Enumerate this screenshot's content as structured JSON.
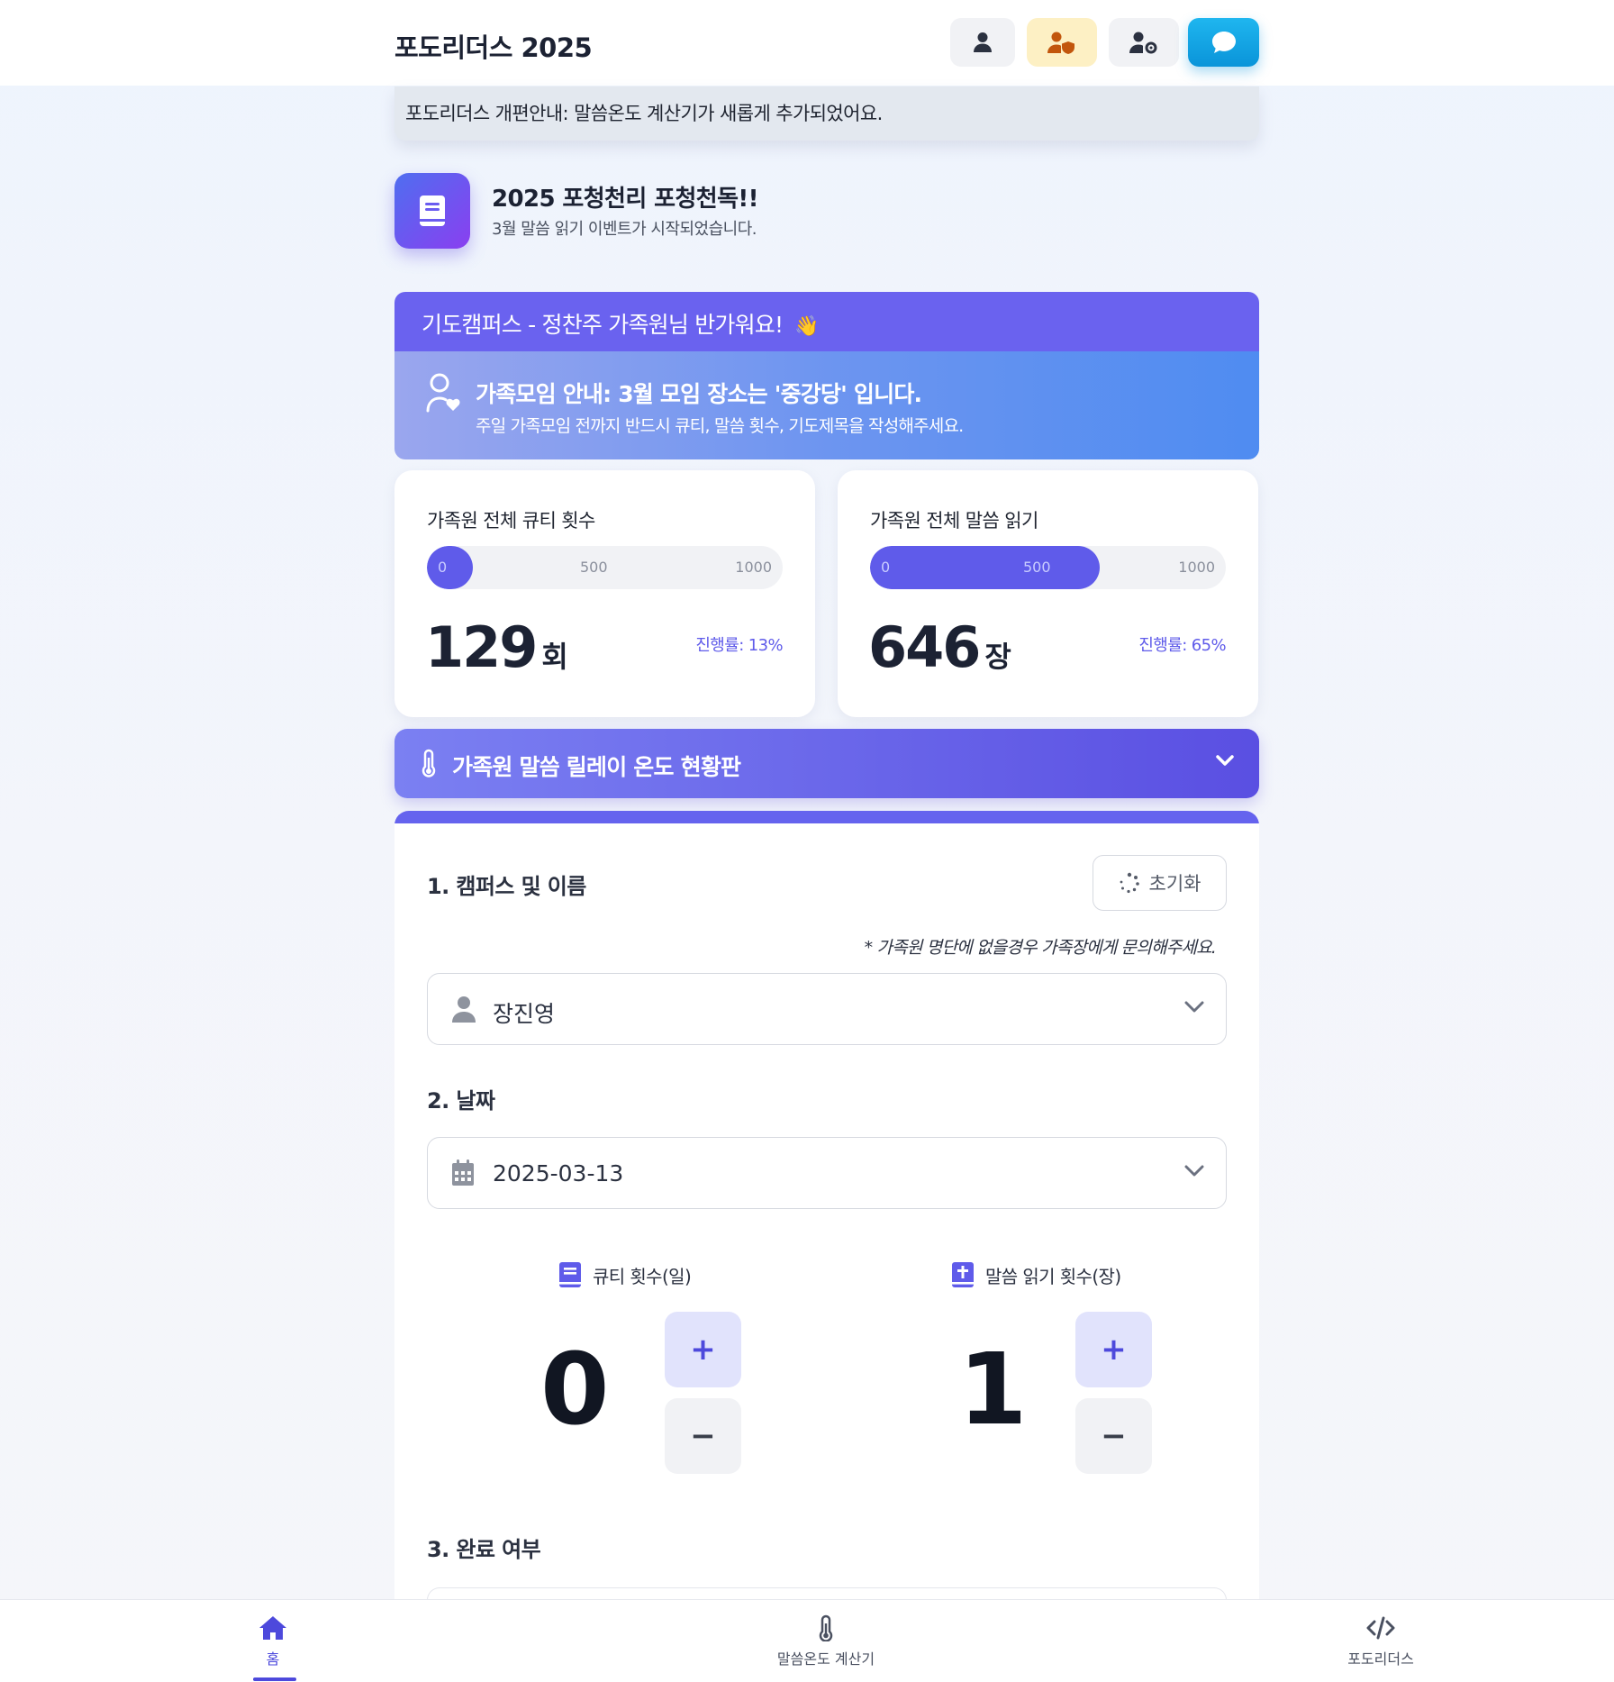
{
  "header": {
    "brand": "포도리더스 2025"
  },
  "notice": "포도리더스 개편안내: 말씀온도 계산기가 새롭게 추가되었어요.",
  "event": {
    "title": "2025 포청천리 포청천독!!",
    "subtitle": "3월 말씀 읽기 이벤트가 시작되었습니다."
  },
  "welcome": {
    "text": "기도캠퍼스 - 정찬주 가족원님 반가워요!",
    "emoji": "👋"
  },
  "family_notice": {
    "title": "가족모임 안내: 3월 모임 장소는 '중강당' 입니다.",
    "subtitle": "주일 가족모임 전까지 반드시 큐티, 말씀 횟수, 기도제목을 작성해주세요."
  },
  "stats": [
    {
      "label": "가족원 전체 큐티 횟수",
      "value": "129",
      "unit": "회",
      "progress_text": "진행률: 13%",
      "progress": 0.13,
      "ticks": [
        "0",
        "500",
        "1000"
      ]
    },
    {
      "label": "가족원 전체 말씀 읽기",
      "value": "646",
      "unit": "장",
      "progress_text": "진행률: 65%",
      "progress": 0.646,
      "ticks": [
        "0",
        "500",
        "1000"
      ]
    }
  ],
  "relay": {
    "title": "가족원 말씀 릴레이 온도 현황판"
  },
  "form": {
    "section1": "1. 캠퍼스 및 이름",
    "reset_label": "초기화",
    "hint": "* 가족원 명단에 없을경우 가족장에게 문의해주세요.",
    "name_value": "장진영",
    "section2": "2. 날짜",
    "date_value": "2025-03-13",
    "qt_label": "큐티 횟수(일)",
    "qt_value": "0",
    "reading_label": "말씀 읽기 횟수(장)",
    "reading_value": "1",
    "plus": "+",
    "minus": "−",
    "section3": "3. 완료 여부"
  },
  "bottom_nav": [
    {
      "label": "홈",
      "icon": "home-icon",
      "active": true
    },
    {
      "label": "말씀온도 계산기",
      "icon": "thermometer-icon",
      "active": false
    },
    {
      "label": "포도리더스",
      "icon": "code-icon",
      "active": false
    }
  ],
  "colors": {
    "accent": "#5f5bea",
    "header_bg": "#ffffff",
    "chat_button": "#0ea5e9",
    "shield_button": "#fdf0c4"
  }
}
